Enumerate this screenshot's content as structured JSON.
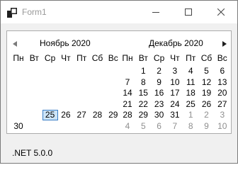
{
  "window": {
    "title": "Form1",
    "controls": {
      "minimize": "minimize",
      "maximize": "maximize",
      "close": "close"
    }
  },
  "calendar": {
    "months": [
      {
        "title": "Ноябрь 2020",
        "weekdays": [
          "Пн",
          "Вт",
          "Ср",
          "Чт",
          "Пт",
          "Сб",
          "Вс"
        ],
        "weeks": [
          [
            "",
            "",
            "",
            "",
            "",
            "",
            ""
          ],
          [
            "",
            "",
            "",
            "",
            "",
            "",
            ""
          ],
          [
            "",
            "",
            "",
            "",
            "",
            "",
            ""
          ],
          [
            "",
            "",
            "",
            "",
            "",
            "",
            ""
          ],
          [
            "",
            "",
            "25",
            "26",
            "27",
            "28",
            "29"
          ],
          [
            "30",
            "",
            "",
            "",
            "",
            "",
            ""
          ]
        ],
        "today": "25"
      },
      {
        "title": "Декабрь 2020",
        "weekdays": [
          "Пн",
          "Вт",
          "Ср",
          "Чт",
          "Пт",
          "Сб",
          "Вс"
        ],
        "weeks": [
          [
            "",
            "1",
            "2",
            "3",
            "4",
            "5",
            "6"
          ],
          [
            "7",
            "8",
            "9",
            "10",
            "11",
            "12",
            "13"
          ],
          [
            "14",
            "15",
            "16",
            "17",
            "18",
            "19",
            "20"
          ],
          [
            "21",
            "22",
            "23",
            "24",
            "25",
            "26",
            "27"
          ],
          [
            "28",
            "29",
            "30",
            "31",
            "1",
            "2",
            "3"
          ],
          [
            "4",
            "5",
            "6",
            "7",
            "8",
            "9",
            "10"
          ]
        ],
        "gray_from": {
          "week": 4,
          "day": 4
        }
      }
    ]
  },
  "status": {
    "label": ".NET 5.0.0"
  }
}
